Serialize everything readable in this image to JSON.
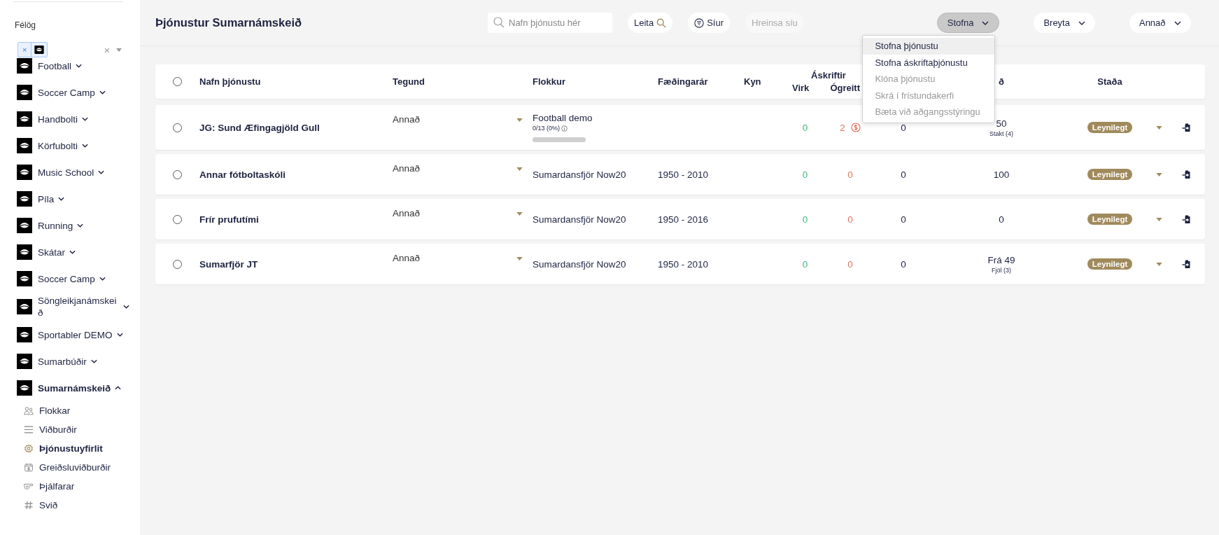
{
  "sidebar": {
    "section_label": "Félög",
    "filter": {
      "chips": [
        {
          "remove": "×"
        }
      ],
      "clear": "×"
    },
    "clubs": [
      {
        "name": "Football",
        "expanded": false,
        "selected": false
      },
      {
        "name": "Soccer Camp",
        "expanded": false,
        "selected": false
      },
      {
        "name": "Handbolti",
        "expanded": false,
        "selected": false
      },
      {
        "name": "Körfubolti",
        "expanded": false,
        "selected": false
      },
      {
        "name": "Music School",
        "expanded": false,
        "selected": false
      },
      {
        "name": "Píla",
        "expanded": false,
        "selected": false
      },
      {
        "name": "Running",
        "expanded": false,
        "selected": false
      },
      {
        "name": "Skátar",
        "expanded": false,
        "selected": false
      },
      {
        "name": "Soccer Camp",
        "expanded": false,
        "selected": false
      },
      {
        "name": "Söngleikjanámskeið",
        "expanded": false,
        "selected": false
      },
      {
        "name": "Sportabler DEMO",
        "expanded": false,
        "selected": false
      },
      {
        "name": "Sumarbúðir",
        "expanded": false,
        "selected": false
      },
      {
        "name": "Sumarnámskeið",
        "expanded": true,
        "selected": true,
        "children": [
          {
            "label": "Flokkar",
            "kind": "people",
            "selected": false
          },
          {
            "label": "Viðburðir",
            "kind": "list",
            "selected": false
          },
          {
            "label": "Þjónustuyfirlit",
            "kind": "gear",
            "selected": true
          },
          {
            "label": "Greiðsluviðburðir",
            "kind": "payment",
            "selected": false
          },
          {
            "label": "Þjálfarar",
            "kind": "whistle",
            "selected": false
          },
          {
            "label": "Svið",
            "kind": "hash",
            "selected": false
          }
        ]
      }
    ]
  },
  "header": {
    "title": "Þjónustur Sumarnámskeið",
    "search": {
      "placeholder": "Nafn þjónustu hér"
    },
    "search_button": "Leita",
    "filter_button": "Síur",
    "clear_filter_button": {
      "label": "Hreinsa síu",
      "disabled": true
    },
    "actions": [
      {
        "label": "Stofna",
        "open": true
      },
      {
        "label": "Breyta",
        "open": false
      },
      {
        "label": "Annað",
        "open": false
      }
    ],
    "menu": [
      {
        "label": "Stofna þjónustu",
        "disabled": false,
        "highlighted": true
      },
      {
        "label": "Stofna áskriftaþjónustu",
        "disabled": false,
        "highlighted": false
      },
      {
        "label": "Klóna þjónustu",
        "disabled": true,
        "highlighted": false
      },
      {
        "label": "Skrá í frístundakerfi",
        "disabled": true,
        "highlighted": false
      },
      {
        "label": "Bæta við aðgangsstýringu",
        "disabled": true,
        "highlighted": false
      }
    ]
  },
  "table": {
    "all_selected": false,
    "columns": {
      "name": "Nafn þjónustu",
      "type": "Tegund",
      "category": "Flokkur",
      "birth_years": "Fæðingarár",
      "gender": "Kyn",
      "subscriptions": "Áskriftir",
      "active": "Virk",
      "unpaid": "Ógreitt",
      "column_9": "ð",
      "status": "Staða"
    },
    "rows": [
      {
        "selected": false,
        "name": "JG: Sund Æfingagjöld Gull",
        "type": "Annað",
        "category": "Football demo",
        "progress": {
          "text": "0/13 (0%)",
          "level": 0
        },
        "birth_years": "",
        "active": "0",
        "unpaid": "2",
        "unpaid_warning": true,
        "column_8": "0",
        "price": "50",
        "price_note": "Stakt (4)",
        "status": "Leynilegt"
      },
      {
        "selected": false,
        "name": "Annar fótboltaskóli",
        "type": "Annað",
        "category": "Sumardansfjör Now20",
        "birth_years": "1950 - 2010",
        "active": "0",
        "unpaid": "0",
        "unpaid_warning": false,
        "column_8": "0",
        "price": "100",
        "status": "Leynilegt"
      },
      {
        "selected": false,
        "name": "Frír prufutími",
        "type": "Annað",
        "category": "Sumardansfjör Now20",
        "birth_years": "1950 - 2016",
        "active": "0",
        "unpaid": "0",
        "unpaid_warning": false,
        "column_8": "0",
        "price": "0",
        "status": "Leynilegt"
      },
      {
        "selected": false,
        "name": "Sumarfjör JT",
        "type": "Annað",
        "category": "Sumardansfjör Now20",
        "birth_years": "1950 - 2010",
        "active": "0",
        "unpaid": "0",
        "unpaid_warning": false,
        "column_8": "0",
        "price": "Frá 49",
        "price_note": "Fjöl (3)",
        "status": "Leynilegt"
      }
    ]
  }
}
